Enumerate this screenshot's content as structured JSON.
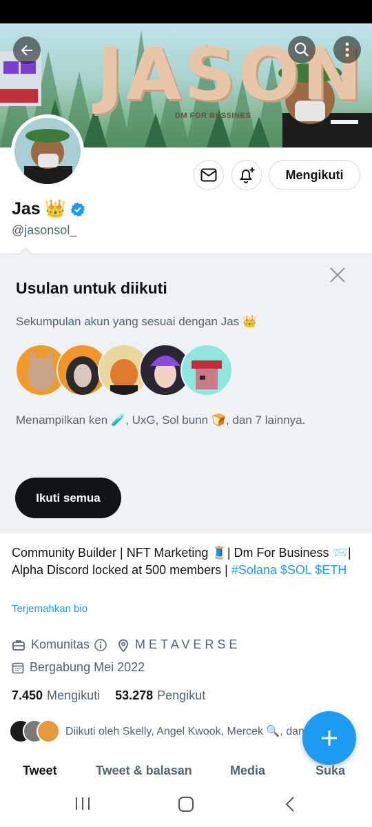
{
  "banner": {
    "title": "JASON",
    "subtitle": "DM FOR BUSSINES"
  },
  "profile": {
    "name": "Jas",
    "name_emoji": "👑",
    "handle": "@jasonsol_",
    "follow_state_label": "Mengikuti"
  },
  "suggestions": {
    "title": "Usulan untuk diikuti",
    "subtitle": "Sekumpulan akun yang sesuai dengan Jas 👑",
    "meta": "Menampilkan ken 🧪, UxG, Sol bunn 🍞, dan 7 lainnya.",
    "follow_all_label": "Ikuti semua"
  },
  "bio": {
    "text_part1": "Community Builder | NFT Marketing 🧵| Dm For Business 📨| Alpha Discord locked at 500 members | ",
    "tag1": "#Solana",
    "tag2": "$SOL",
    "tag3": "$ETH",
    "translate_label": "Terjemahkan bio"
  },
  "meta": {
    "category": "Komunitas",
    "location": "METAVERSE",
    "joined": "Bergabung Mei 2022"
  },
  "counts": {
    "following_value": "7.450",
    "following_label": "Mengikuti",
    "followers_value": "53.278",
    "followers_label": "Pengikut"
  },
  "followed_by": {
    "text": "Diikuti oleh Skelly, Angel Kwook, Mercek 🔍, dan"
  },
  "tabs": {
    "tweet": "Tweet",
    "replies": "Tweet & balasan",
    "media": "Media",
    "likes": "Suka"
  },
  "colors": {
    "accent": "#1d9bf0",
    "text_primary": "#0f1419",
    "text_secondary": "#536471",
    "suggest_bg": "#eef2f4"
  }
}
